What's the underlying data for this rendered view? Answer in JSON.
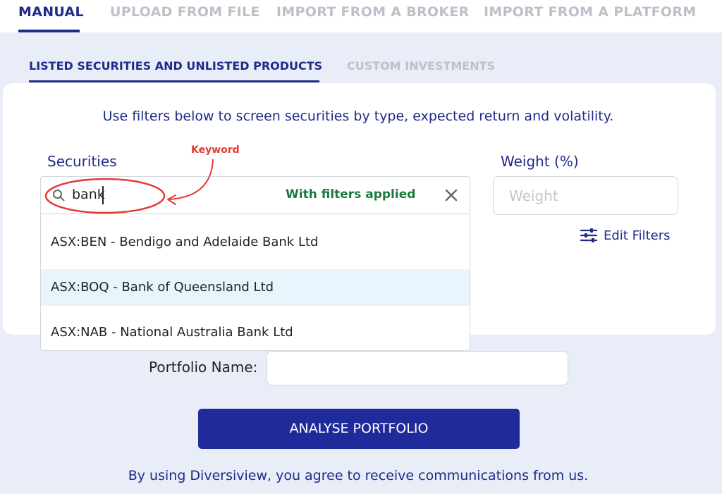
{
  "tabs": [
    {
      "label": "MANUAL",
      "active": true
    },
    {
      "label": "UPLOAD FROM FILE",
      "active": false
    },
    {
      "label": "IMPORT FROM A BROKER",
      "active": false
    },
    {
      "label": "IMPORT FROM A PLATFORM",
      "active": false
    }
  ],
  "subtabs": [
    {
      "label": "LISTED SECURITIES AND UNLISTED PRODUCTS",
      "active": true
    },
    {
      "label": "CUSTOM INVESTMENTS",
      "active": false
    }
  ],
  "form": {
    "instructions": "Use filters below to screen securities by type, expected return and volatility.",
    "securities_label": "Securities",
    "search_value": "bank",
    "search_icon": "search-icon",
    "clear_icon": "close-icon",
    "options": [
      "ASX:BEN - Bendigo and Adelaide Bank Ltd",
      "ASX:BOQ - Bank of Queensland Ltd",
      "ASX:NAB - National Australia Bank Ltd"
    ],
    "highlighted_option": 1,
    "weight_label": "Weight (%)",
    "weight_placeholder": "Weight",
    "weight_value": "",
    "edit_filters_label": "Edit Filters",
    "edit_filters_icon": "sliders-icon",
    "portfolio_name_label": "Portfolio Name:",
    "portfolio_name_value": ""
  },
  "annotations": {
    "keyword": "Keyword",
    "filters_applied": "With filters applied"
  },
  "actions": {
    "analyse_label": "ANALYSE PORTFOLIO"
  },
  "footer": {
    "note": "By using Diversiview, you agree to receive communications from us."
  },
  "colors": {
    "primary": "#1f2a8a",
    "button": "#1f2a9b",
    "background": "#e9edf8",
    "highlight": "#e9f5fc",
    "annotation_red": "#e53935",
    "annotation_green": "#1a7a3c"
  }
}
